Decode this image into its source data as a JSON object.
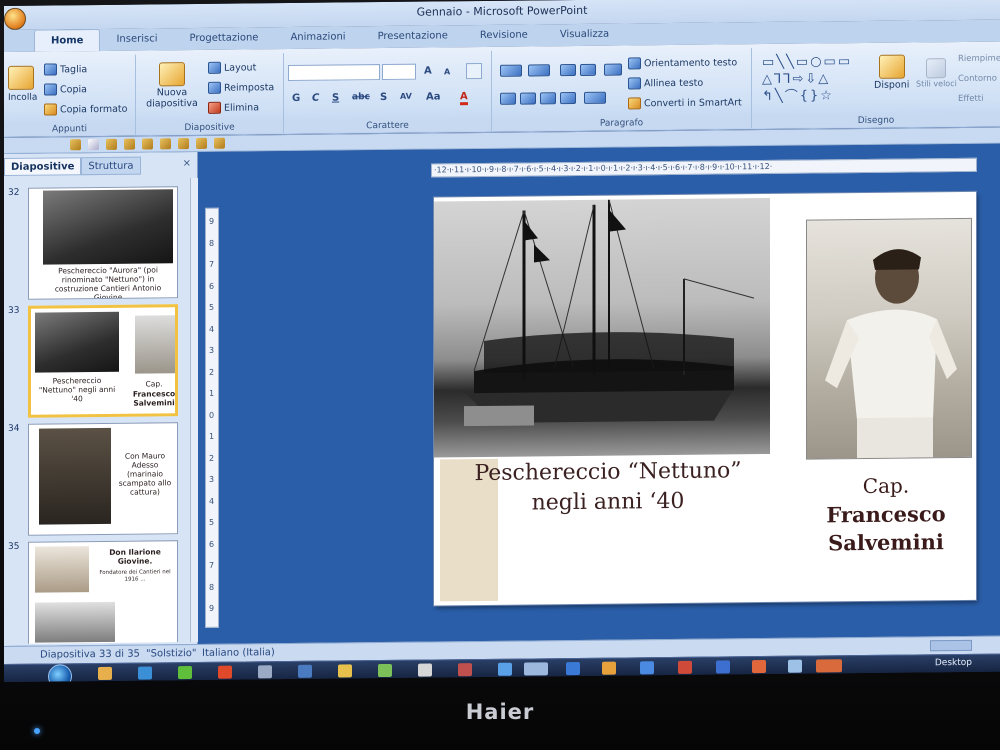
{
  "window": {
    "title": "Gennaio - Microsoft PowerPoint"
  },
  "ribbon": {
    "tabs": [
      "Home",
      "Inserisci",
      "Progettazione",
      "Animazioni",
      "Presentazione",
      "Revisione",
      "Visualizza"
    ],
    "active_tab": "Home",
    "clipboard": {
      "paste": "Incolla",
      "cut": "Taglia",
      "copy": "Copia",
      "format_painter": "Copia formato",
      "label": "Appunti"
    },
    "slides": {
      "new_slide": "Nuova diapositiva",
      "layout": "Layout",
      "reset": "Reimposta",
      "delete": "Elimina",
      "label": "Diapositive"
    },
    "font": {
      "bold": "G",
      "italic": "C",
      "underline": "S",
      "strike": "abc",
      "shadow": "S",
      "spacing": "AV",
      "case": "Aa",
      "color": "A",
      "grow": "A",
      "shrink": "A",
      "label": "Carattere"
    },
    "paragraph": {
      "text_direction": "Orientamento testo",
      "align_text": "Allinea testo",
      "smartart": "Converti in SmartArt",
      "label": "Paragrafo"
    },
    "drawing": {
      "arrange": "Disponi",
      "quick_styles": "Stili veloci",
      "shape_fill": "Riempimento",
      "shape_outline": "Contorno",
      "shape_effects": "Effetti",
      "label": "Disegno"
    }
  },
  "panel": {
    "tabs": [
      "Diapositive",
      "Struttura"
    ],
    "close": "×",
    "thumbnails": [
      {
        "number": "32",
        "caption": "Peschereccio \"Aurora\" (poi rinominato \"Nettuno\") in costruzione Cantieri Antonio Giovine"
      },
      {
        "number": "33",
        "caption_left": "Peschereccio \"Nettuno\" negli anni '40",
        "caption_right_title": "Cap.",
        "caption_right_name": "Francesco Salvemini"
      },
      {
        "number": "34",
        "caption": "Con Mauro Adesso (marinaio scampato allo cattura)"
      },
      {
        "number": "35",
        "caption": "Don Ilarione Giovine.",
        "caption_small": "Fondatore dei Cantieri nel 1916 ..."
      }
    ]
  },
  "ruler": {
    "horizontal": "·12·ı·11·ı·10·ı·9·ı·8·ı·7·ı·6·ı·5·ı·4·ı·3·ı·2·ı·1·ı·0·ı·1·ı·2·ı·3·ı·4·ı·5·ı·6·ı·7·ı·8·ı·9·ı·10·ı·11·ı·12·"
  },
  "slide": {
    "caption_boat_line1": "Peschereccio “Nettuno”",
    "caption_boat_line2": "negli anni ‘40",
    "captain_title": "Cap.",
    "captain_name_line1": "Francesco",
    "captain_name_line2": "Salvemini"
  },
  "statusbar": {
    "slide_counter": "Diapositiva 33 di 35",
    "theme": "\"Solstizio\"",
    "language": "Italiano (Italia)"
  },
  "taskbar": {
    "desktop": "Desktop"
  },
  "monitor": {
    "brand": "Haier"
  },
  "colors": {
    "ribbon": "#cfe0f5",
    "workspace": "#2a5ea8",
    "selection": "#f2c343",
    "caption": "#3a2020"
  }
}
